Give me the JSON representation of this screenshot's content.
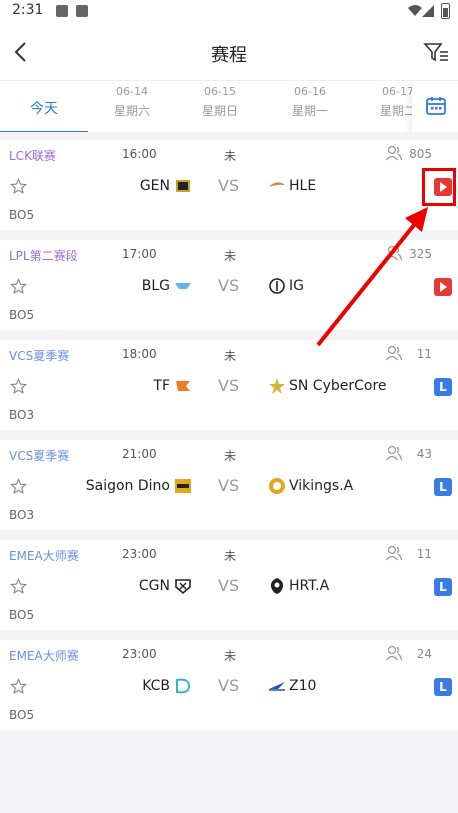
{
  "status_bar": {
    "time": "2:31"
  },
  "header": {
    "title": "赛程"
  },
  "tabs": [
    {
      "label": "今天",
      "active": true
    },
    {
      "date": "06-14",
      "weekday": "星期六"
    },
    {
      "date": "06-15",
      "weekday": "星期日"
    },
    {
      "date": "06-16",
      "weekday": "星期一"
    },
    {
      "date": "06-17",
      "weekday": "星期二"
    }
  ],
  "matches": [
    {
      "league": "LCK联赛",
      "league_color": "#9a6bd9",
      "time": "16:00",
      "state": "未",
      "viewers": "805",
      "home": "GEN",
      "away": "HLE",
      "vs": "VS",
      "format": "BO5",
      "stream": "youtube-icon"
    },
    {
      "league": "LPL第二赛段",
      "league_color": "#9a6bd9",
      "time": "17:00",
      "state": "未",
      "viewers": "325",
      "home": "BLG",
      "away": "IG",
      "vs": "VS",
      "format": "BO5",
      "stream": "youtube-icon"
    },
    {
      "league": "VCS夏季赛",
      "league_color": "#6a8fe0",
      "time": "18:00",
      "state": "未",
      "viewers": "11",
      "home": "TF",
      "away": "SN CyberCore",
      "vs": "VS",
      "format": "BO3",
      "stream": "lol-icon"
    },
    {
      "league": "VCS夏季赛",
      "league_color": "#6a8fe0",
      "time": "21:00",
      "state": "未",
      "viewers": "43",
      "home": "Saigon Dino",
      "away": "Vikings.A",
      "vs": "VS",
      "format": "BO3",
      "stream": "lol-icon"
    },
    {
      "league": "EMEA大师赛",
      "league_color": "#6a8fe0",
      "time": "23:00",
      "state": "未",
      "viewers": "11",
      "home": "CGN",
      "away": "HRT.A",
      "vs": "VS",
      "format": "BO5",
      "stream": "lol-icon"
    },
    {
      "league": "EMEA大师赛",
      "league_color": "#6a8fe0",
      "time": "23:00",
      "state": "未",
      "viewers": "24",
      "home": "KCB",
      "away": "Z10",
      "vs": "VS",
      "format": "BO5",
      "stream": "lol-icon"
    }
  ],
  "colors": {
    "accent": "#2f7bd8",
    "annotation": "#e00000"
  }
}
